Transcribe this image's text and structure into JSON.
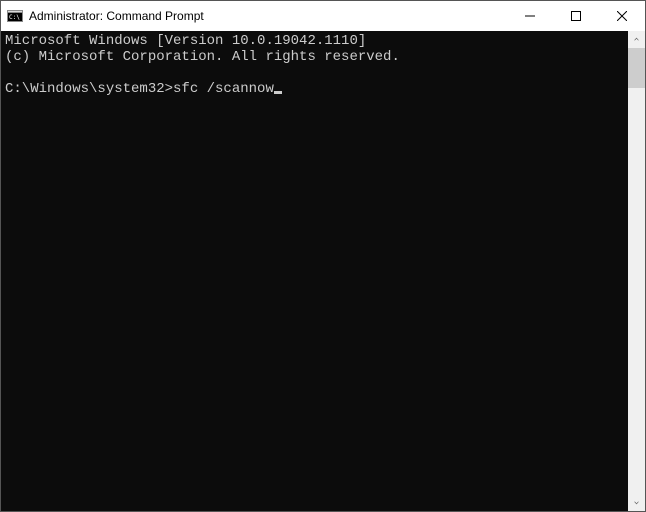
{
  "window": {
    "title": "Administrator: Command Prompt",
    "icons": {
      "app": "cmd-icon",
      "minimize": "minimize-icon",
      "maximize": "maximize-icon",
      "close": "close-icon"
    }
  },
  "terminal": {
    "lines": [
      "Microsoft Windows [Version 10.0.19042.1110]",
      "(c) Microsoft Corporation. All rights reserved.",
      "",
      "C:\\Windows\\system32>sfc /scannow"
    ],
    "prompt": "C:\\Windows\\system32>",
    "command": "sfc /scannow"
  },
  "scrollbar": {
    "up": "scroll-up-icon",
    "down": "scroll-down-icon"
  },
  "colors": {
    "terminal_bg": "#0c0c0c",
    "terminal_fg": "#cccccc",
    "titlebar_bg": "#ffffff"
  }
}
